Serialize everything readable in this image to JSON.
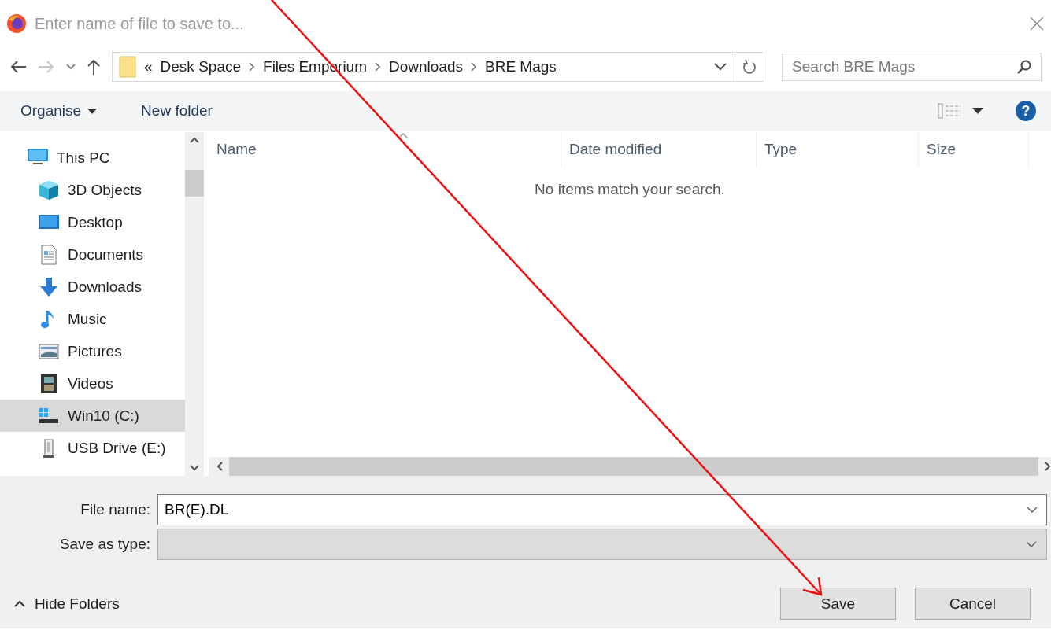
{
  "window": {
    "title": "Enter name of file to save to..."
  },
  "address_bar": {
    "overflow": "«",
    "path": [
      "Desk Space",
      "Files Emporium",
      "Downloads",
      "BRE Mags"
    ]
  },
  "search": {
    "placeholder": "Search BRE Mags"
  },
  "toolbar": {
    "help": "?",
    "items": [
      {
        "label": "Organise",
        "kind": "menu"
      },
      {
        "label": "New folder",
        "kind": "button"
      }
    ]
  },
  "sidebar": {
    "items": [
      {
        "label": "This PC",
        "kind": "pc",
        "selected": false,
        "children": [
          {
            "label": "3D Objects",
            "kind": "objects3d",
            "selected": false
          },
          {
            "label": "Desktop",
            "kind": "desktop",
            "selected": false
          },
          {
            "label": "Documents",
            "kind": "documents",
            "selected": false
          },
          {
            "label": "Downloads",
            "kind": "downloads",
            "selected": false
          },
          {
            "label": "Music",
            "kind": "music",
            "selected": false
          },
          {
            "label": "Pictures",
            "kind": "pictures",
            "selected": false
          },
          {
            "label": "Videos",
            "kind": "videos",
            "selected": false
          },
          {
            "label": "Win10 (C:)",
            "kind": "drive",
            "selected": true
          },
          {
            "label": "USB Drive (E:)",
            "kind": "usb",
            "selected": false
          }
        ]
      }
    ]
  },
  "table": {
    "columns": [
      "Name",
      "Date modified",
      "Type",
      "Size"
    ],
    "empty_message": "No items match your search."
  },
  "form": {
    "file_name_label": "File name:",
    "file_name": "BR(E).DL",
    "type_label": "Save as type:"
  },
  "footer": {
    "hide_folders": "Hide Folders",
    "buttons": [
      "Save",
      "Cancel"
    ]
  }
}
